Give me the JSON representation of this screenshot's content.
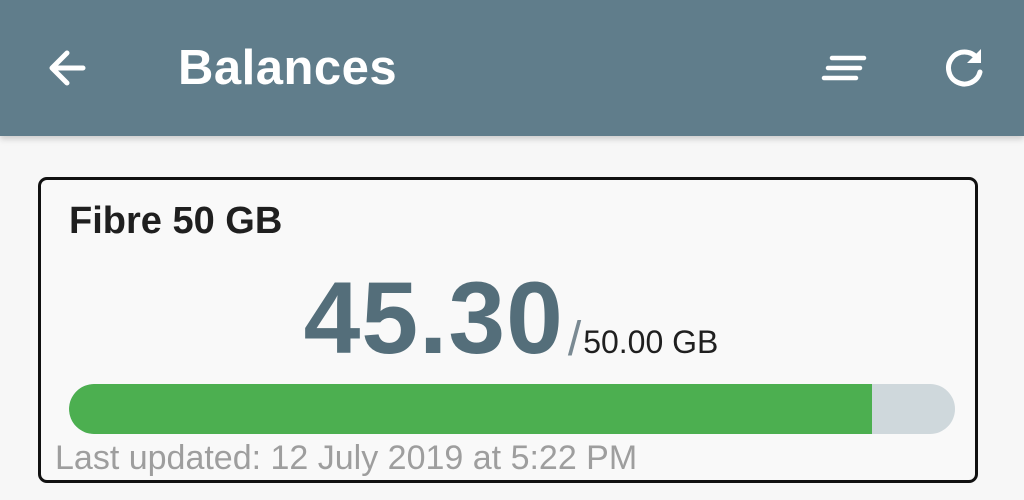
{
  "appbar": {
    "title": "Balances",
    "icons": {
      "back": "arrow-left-icon",
      "filter": "sort-lines-icon",
      "refresh": "refresh-icon"
    },
    "color": "#607d8b"
  },
  "balance_card": {
    "name": "Fibre 50 GB",
    "remaining": "45.30",
    "separator": "/",
    "total": "50.00 GB",
    "used_fraction": 0.906,
    "last_updated": "Last updated: 12 July 2019 at 5:22 PM",
    "fill_color": "#4caf50",
    "track_color": "#cfd8dc"
  }
}
